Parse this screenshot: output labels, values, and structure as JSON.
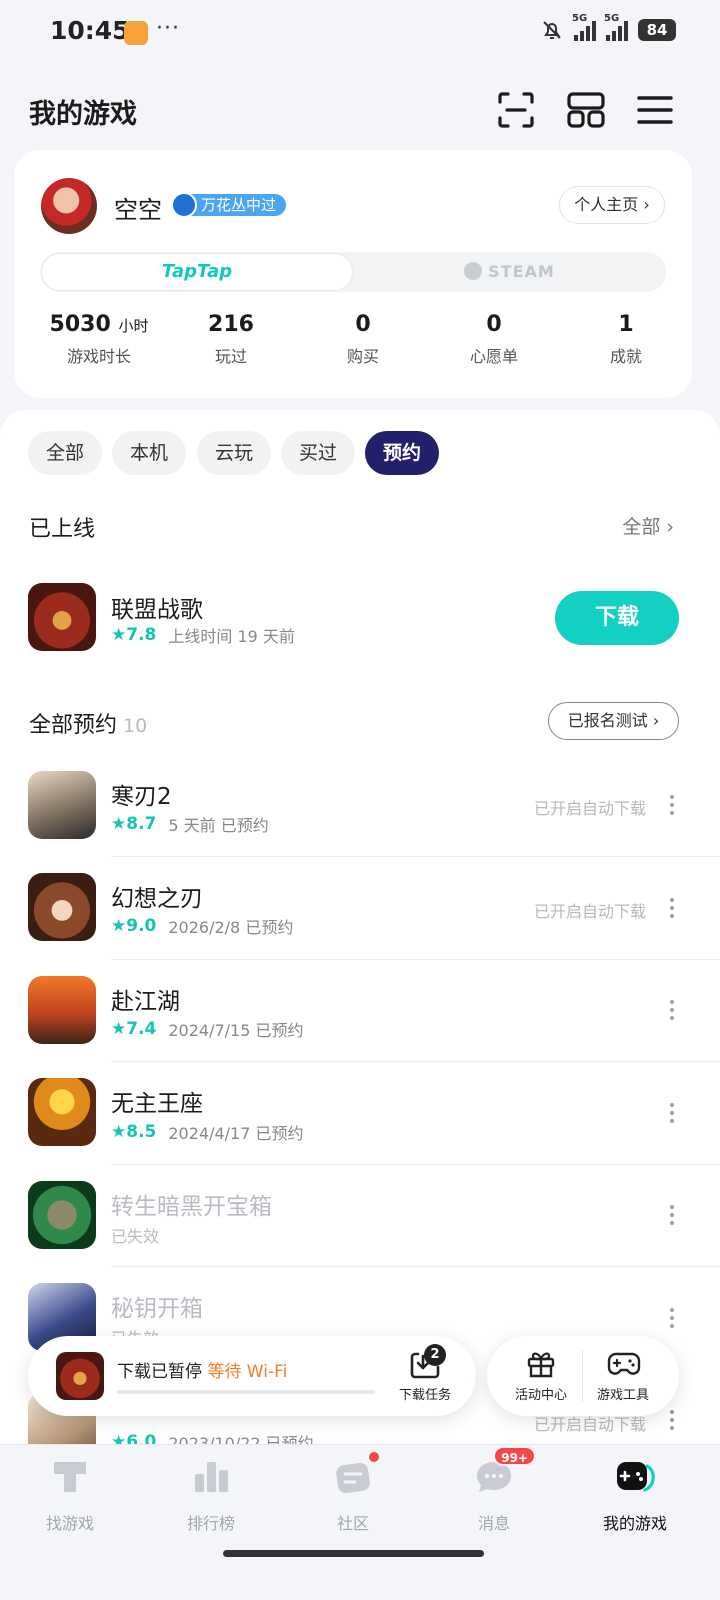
{
  "status_bar": {
    "time": "10:45",
    "more": "···",
    "network1": "5G",
    "network2": "5G",
    "battery": "84",
    "icons": [
      "app-notification-icon",
      "mute-bell-icon",
      "signal-icon",
      "battery-icon"
    ]
  },
  "header": {
    "title": "我的游戏",
    "icons": [
      "scan-icon",
      "grid-icon",
      "menu-icon"
    ]
  },
  "profile": {
    "username": "空空",
    "badge": "万花丛中过",
    "home_button": "个人主页",
    "platforms": {
      "taptap": "TapTap",
      "steam": "STEAM",
      "active": "TapTap"
    },
    "stats": {
      "hours_value": "5030",
      "hours_unit": "小时",
      "hours_label": "游戏时长",
      "played_value": "216",
      "played_label": "玩过",
      "bought_value": "0",
      "bought_label": "购买",
      "wishlist_value": "0",
      "wishlist_label": "心愿单",
      "achieve_value": "1",
      "achieve_label": "成就"
    }
  },
  "filters": {
    "all": "全部",
    "local": "本机",
    "cloud": "云玩",
    "bought": "买过",
    "reserved": "预约",
    "active": "预约"
  },
  "launched": {
    "title": "已上线",
    "see_all": "全部",
    "game": {
      "name": "联盟战歌",
      "rating": "7.8",
      "meta": "上线时间 19 天前",
      "button": "下载"
    }
  },
  "reservations": {
    "title": "全部预约",
    "count": "10",
    "signup_button": "已报名测试",
    "items": [
      {
        "name": "寒刃2",
        "rating": "8.7",
        "meta": "5 天前 已预约",
        "status": "已开启自动下载"
      },
      {
        "name": "幻想之刃",
        "rating": "9.0",
        "meta": "2026/2/8 已预约",
        "status": "已开启自动下载"
      },
      {
        "name": "赴江湖",
        "rating": "7.4",
        "meta": "2024/7/15 已预约",
        "status": ""
      },
      {
        "name": "无主王座",
        "rating": "8.5",
        "meta": "2024/4/17 已预约",
        "status": ""
      },
      {
        "name": "转生暗黑开宝箱",
        "rating": "",
        "meta": "已失效",
        "status": ""
      },
      {
        "name": "秘钥开箱",
        "rating": "",
        "meta": "已失效",
        "status": ""
      },
      {
        "name": "",
        "rating": "6.0",
        "meta": "2023/10/22 已预约",
        "status": "已开启自动下载"
      }
    ]
  },
  "download_bar": {
    "status": "下载已暂停",
    "wifi": "等待 Wi-Fi",
    "task_count": "2",
    "task_label": "下载任务",
    "activity_label": "活动中心",
    "tools_label": "游戏工具"
  },
  "bottom_nav": {
    "find": "找游戏",
    "rank": "排行榜",
    "community": "社区",
    "messages": "消息",
    "messages_badge": "99+",
    "my_games": "我的游戏",
    "active": "我的游戏"
  },
  "colors": {
    "accent": "#14D0C2",
    "active_chip": "#22206A",
    "warning": "#F27C2E",
    "badge_red": "#F44848"
  }
}
